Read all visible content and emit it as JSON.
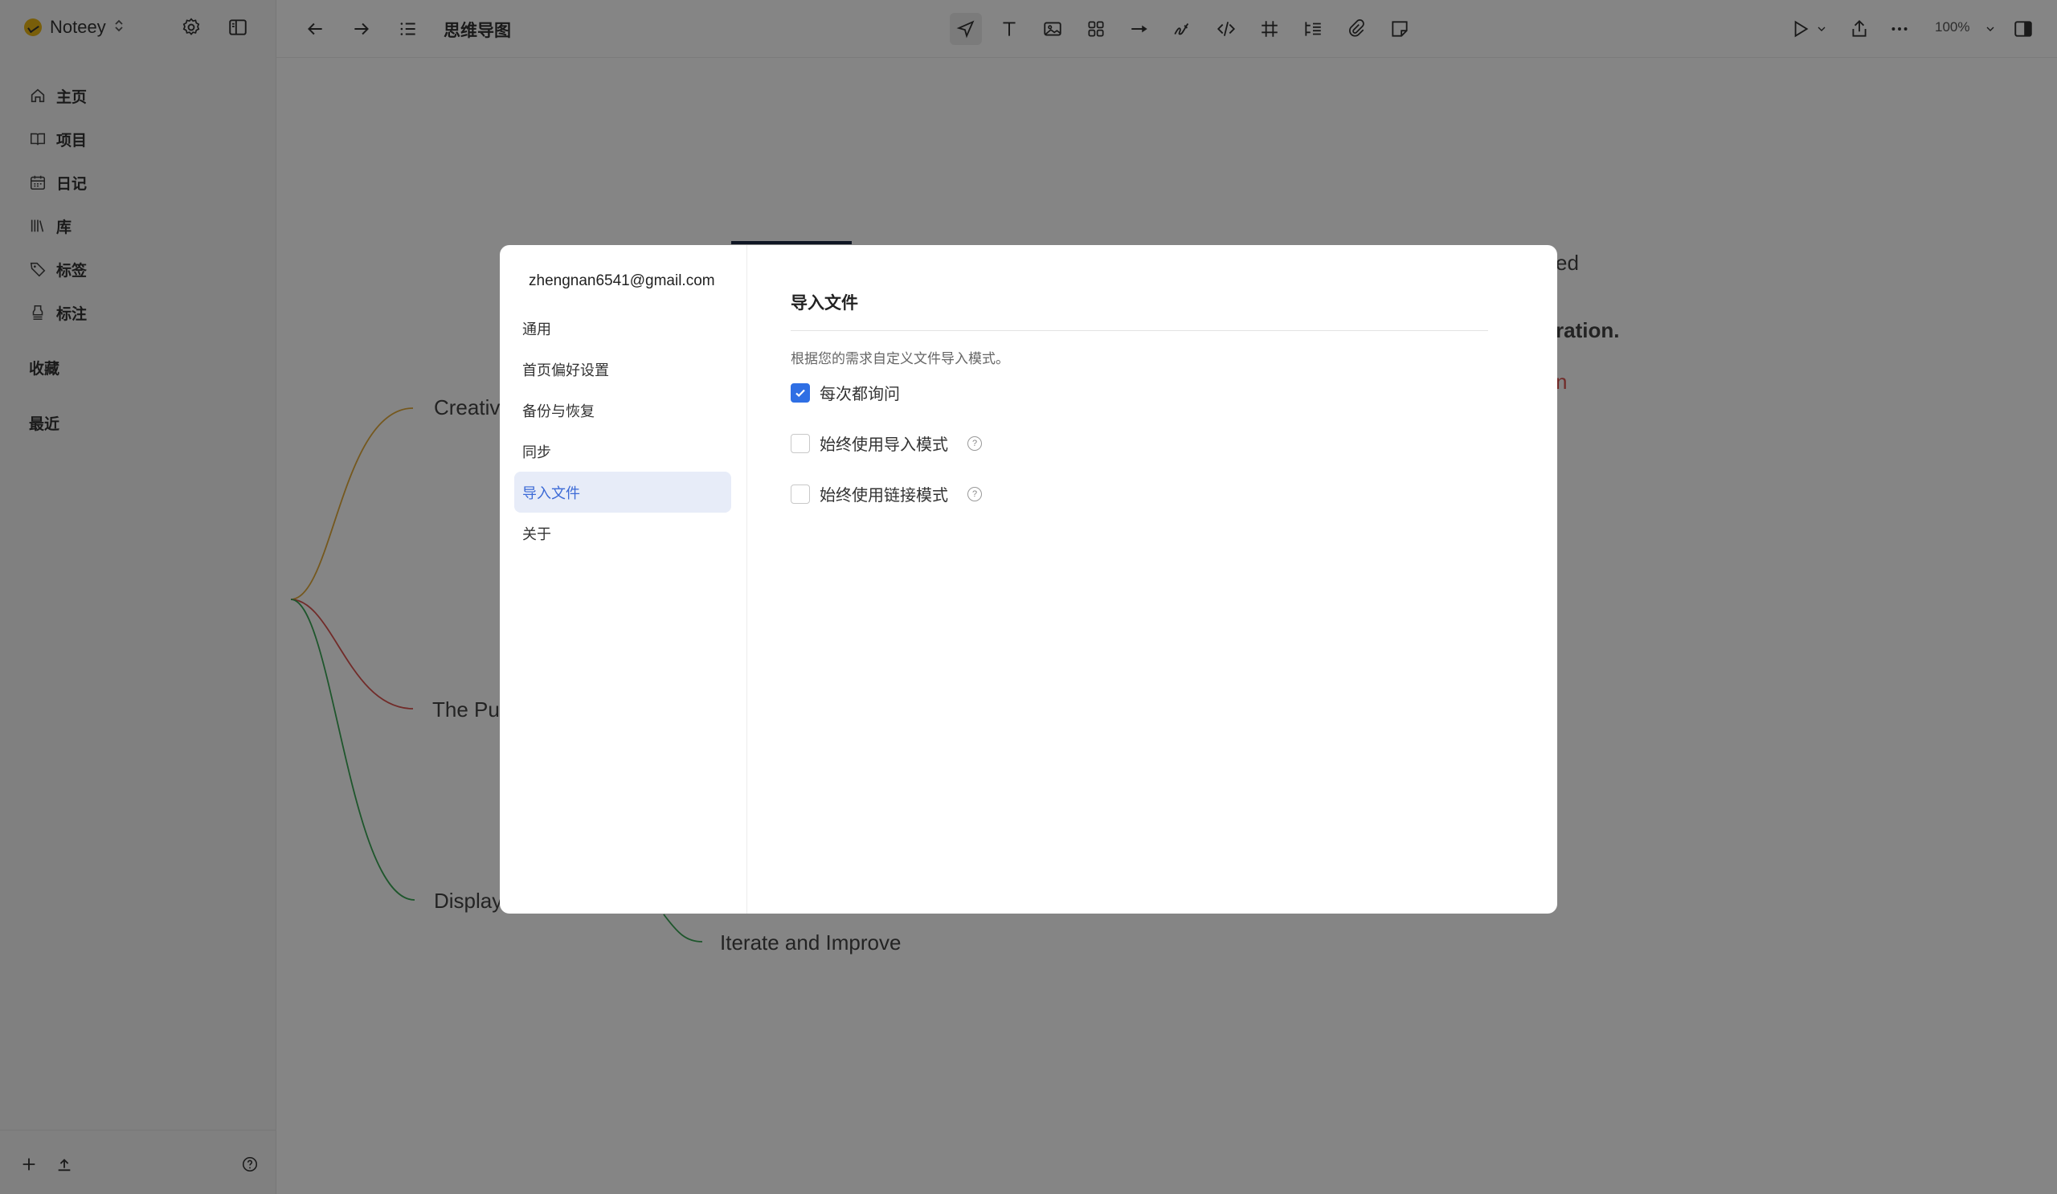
{
  "app": {
    "name": "Noteey"
  },
  "sidebar": {
    "items": [
      {
        "label": "主页",
        "icon": "home-icon"
      },
      {
        "label": "项目",
        "icon": "book-icon"
      },
      {
        "label": "日记",
        "icon": "calendar-icon"
      },
      {
        "label": "库",
        "icon": "library-icon"
      },
      {
        "label": "标签",
        "icon": "tag-icon"
      },
      {
        "label": "标注",
        "icon": "highlighter-icon"
      }
    ],
    "favorites_label": "收藏",
    "recent_label": "最近"
  },
  "toolbar": {
    "doc_title": "思维导图",
    "zoom": "100%"
  },
  "canvas": {
    "nodes": [
      {
        "text": "Creative"
      },
      {
        "text": "The Pur"
      },
      {
        "text": "Display"
      },
      {
        "text": "Iterate and Improve"
      },
      {
        "text": "ed"
      },
      {
        "text": "ration."
      },
      {
        "text": "n"
      }
    ],
    "branch_colors": [
      "#e0a93a",
      "#d9534f",
      "#3aa655"
    ]
  },
  "modal": {
    "account": "zhengnan6541@gmail.com",
    "menu": [
      {
        "label": "通用"
      },
      {
        "label": "首页偏好设置"
      },
      {
        "label": "备份与恢复"
      },
      {
        "label": "同步"
      },
      {
        "label": "导入文件"
      },
      {
        "label": "关于"
      }
    ],
    "active_index": 4,
    "pane": {
      "title": "导入文件",
      "description": "根据您的需求自定义文件导入模式。",
      "options": [
        {
          "label": "每次都询问",
          "checked": true
        },
        {
          "label": "始终使用导入模式",
          "checked": false
        },
        {
          "label": "始终使用链接模式",
          "checked": false
        }
      ]
    },
    "accent_color": "#2f6fe4"
  }
}
